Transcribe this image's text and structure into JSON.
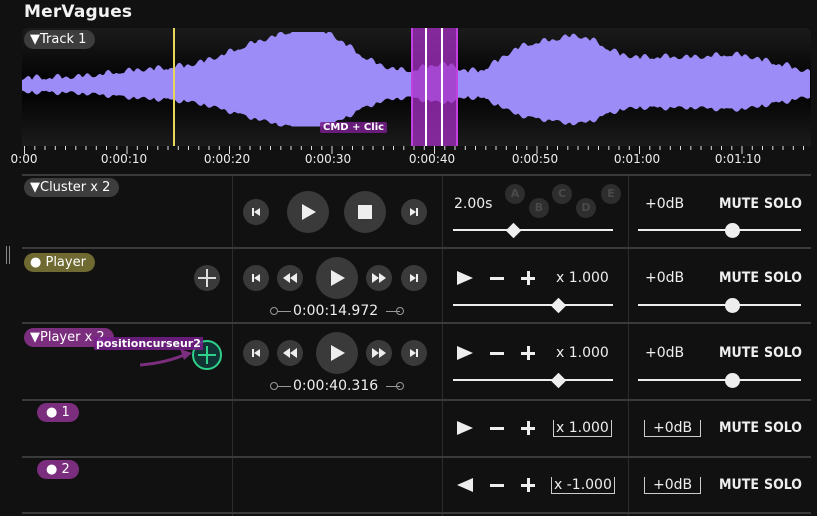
{
  "app": {
    "title": "MerVagues"
  },
  "track": {
    "label": "▼Track 1",
    "annotation": "CMD + Clic",
    "waveform_color": "#9c8cf7",
    "selection_color": "#a82fc4",
    "playhead_color": "#e6d65a"
  },
  "ruler": {
    "ticks": [
      "0:00",
      "0:00:10",
      "0:00:20",
      "0:00:30",
      "0:00:40",
      "0:00:50",
      "0:01:00",
      "0:01:10"
    ]
  },
  "rows": [
    {
      "label": "▼Cluster x 2",
      "duration": "2.00s",
      "letters": [
        "A",
        "B",
        "C",
        "D",
        "E"
      ],
      "gain": "+0dB",
      "mute": "MUTE",
      "solo": "SOLO",
      "speed_slider": 0.38,
      "gain_slider": 0.58
    },
    {
      "label": "● Player",
      "time": "0:00:14.972",
      "speed": "x 1.000",
      "gain": "+0dB",
      "mute": "MUTE",
      "solo": "SOLO",
      "speed_slider": 0.66,
      "gain_slider": 0.58
    },
    {
      "label": "▼Player x 2",
      "annotation": "positioncurseur2",
      "time": "0:00:40.316",
      "speed": "x 1.000",
      "gain": "+0dB",
      "mute": "MUTE",
      "solo": "SOLO",
      "speed_slider": 0.66,
      "gain_slider": 0.58
    },
    {
      "label": "● 1",
      "speed": "x 1.000",
      "gain": "+0dB",
      "mute": "MUTE",
      "solo": "SOLO"
    },
    {
      "label": "● 2",
      "speed": "x -1.000",
      "gain": "+0dB",
      "mute": "MUTE",
      "solo": "SOLO"
    }
  ],
  "icons": {
    "skip_back": "skip-back-icon",
    "rewind": "rewind-icon",
    "play": "play-icon",
    "stop": "stop-icon",
    "fast_forward": "fast-forward-icon",
    "skip_forward": "skip-forward-icon",
    "crosshair": "crosshair-icon"
  },
  "colors": {
    "accent_green": "#2ed08a",
    "pill_olive": "#6f6a32",
    "pill_purple": "#7b2d7e"
  }
}
